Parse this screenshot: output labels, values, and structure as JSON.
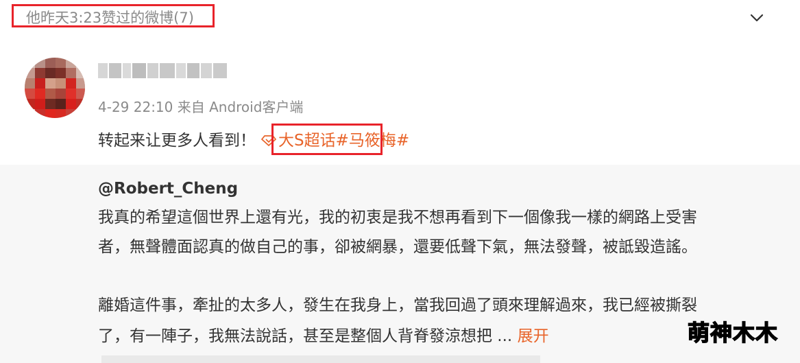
{
  "header": {
    "title": "他昨天3:23赞过的微博(7)",
    "toggle_icon": "chevron-down-icon"
  },
  "post": {
    "avatar": "avatar-pixelated",
    "meta": "4-29 22:10 来自 Android客户端",
    "text_before": "转起来让更多人看到！",
    "topic_icon": "diamond-icon",
    "topic_super": "大S超话",
    "topic_hashtag": "#马筱梅#"
  },
  "repost": {
    "author": "@Robert_Cheng",
    "line1": "我真的希望這個世界上還有光，我的初衷是我不想再看到下一個像我一樣的網路上受害",
    "line2": "者，無聲體面認真的做自己的事，卻被網暴，還要低聲下氣，無法發聲，被詆毀造謠。",
    "line3": "離婚這件事，牽扯的太多人，發生在我身上，當我回過了頭來理解過來，我已經被撕裂",
    "line4": "了，有一陣子，我無法說話，甚至是整個人背脊發涼想把 ... ",
    "expand_label": "展开"
  },
  "watermark": "萌神木木",
  "colors": {
    "highlight_box": "#e8232a",
    "topic_orange": "#e8642a",
    "repost_bg": "#f7f7f7",
    "meta_gray": "#8a8a8a",
    "text_dark": "#333333"
  }
}
